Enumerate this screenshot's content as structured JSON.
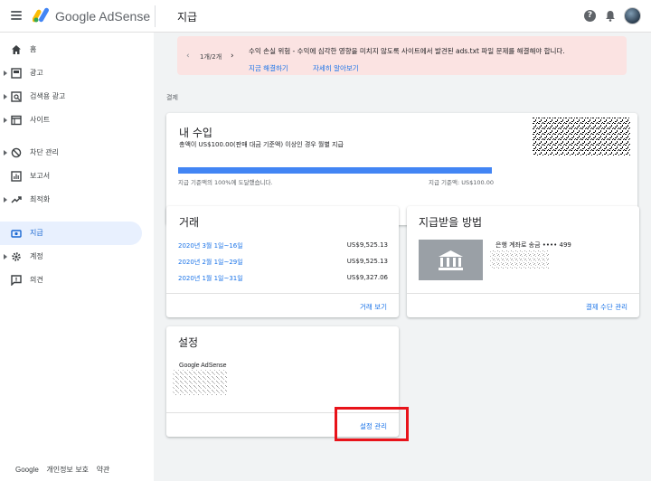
{
  "header": {
    "brand_google": "Google",
    "brand_product": "AdSense",
    "page_title": "지급",
    "help": "?"
  },
  "sidebar": {
    "items": [
      {
        "label": "홈"
      },
      {
        "label": "광고"
      },
      {
        "label": "검색용 광고"
      },
      {
        "label": "사이트"
      },
      {
        "label": "차단 관리"
      },
      {
        "label": "보고서"
      },
      {
        "label": "최적화"
      },
      {
        "label": "지급"
      },
      {
        "label": "계정"
      },
      {
        "label": "의견"
      }
    ],
    "footer": {
      "google": "Google",
      "privacy": "개인정보 보호",
      "terms": "약관"
    }
  },
  "alert": {
    "prev": "‹",
    "counter": "1개/2개",
    "next": "›",
    "message": "수익 손실 위험 - 수익에 심각한 영향을 미치지 않도록 사이트에서 발견된 ads.txt 파일 문제를 해결해야 합니다.",
    "fix_link": "지금 해결하기",
    "learn_link": "자세히 알아보기"
  },
  "section_label": "결제",
  "earnings": {
    "title": "내 수입",
    "subtitle": "총액이 US$100.00(판매 대금 기준액) 이상인 경우 월별 지급",
    "progress": 100,
    "progress_note": "지급 기준액의 100%에 도달했습니다.",
    "threshold": "지급 기준액: US$100.00"
  },
  "transactions": {
    "title": "거래",
    "rows": [
      {
        "date": "2020년 3월 1일~16일",
        "amount": "US$9,525.13"
      },
      {
        "date": "2020년 2월 1일~29일",
        "amount": "US$9,525.13"
      },
      {
        "date": "2020년 1월 1일~31일",
        "amount": "US$9,327.06"
      }
    ],
    "view_link": "거래 보기"
  },
  "payment_method": {
    "title": "지급받을 방법",
    "bank_label": "은행 계좌로 송금 •••• 499",
    "manage_link": "결제 수단 관리"
  },
  "settings": {
    "title": "설정",
    "account_name": "Google AdSense",
    "manage_link": "설정 관리"
  },
  "colors": {
    "accent": "#1a73e8",
    "alert_bg": "#fbe3e2",
    "progress": "#4285f4",
    "highlight": "#e8131a"
  }
}
